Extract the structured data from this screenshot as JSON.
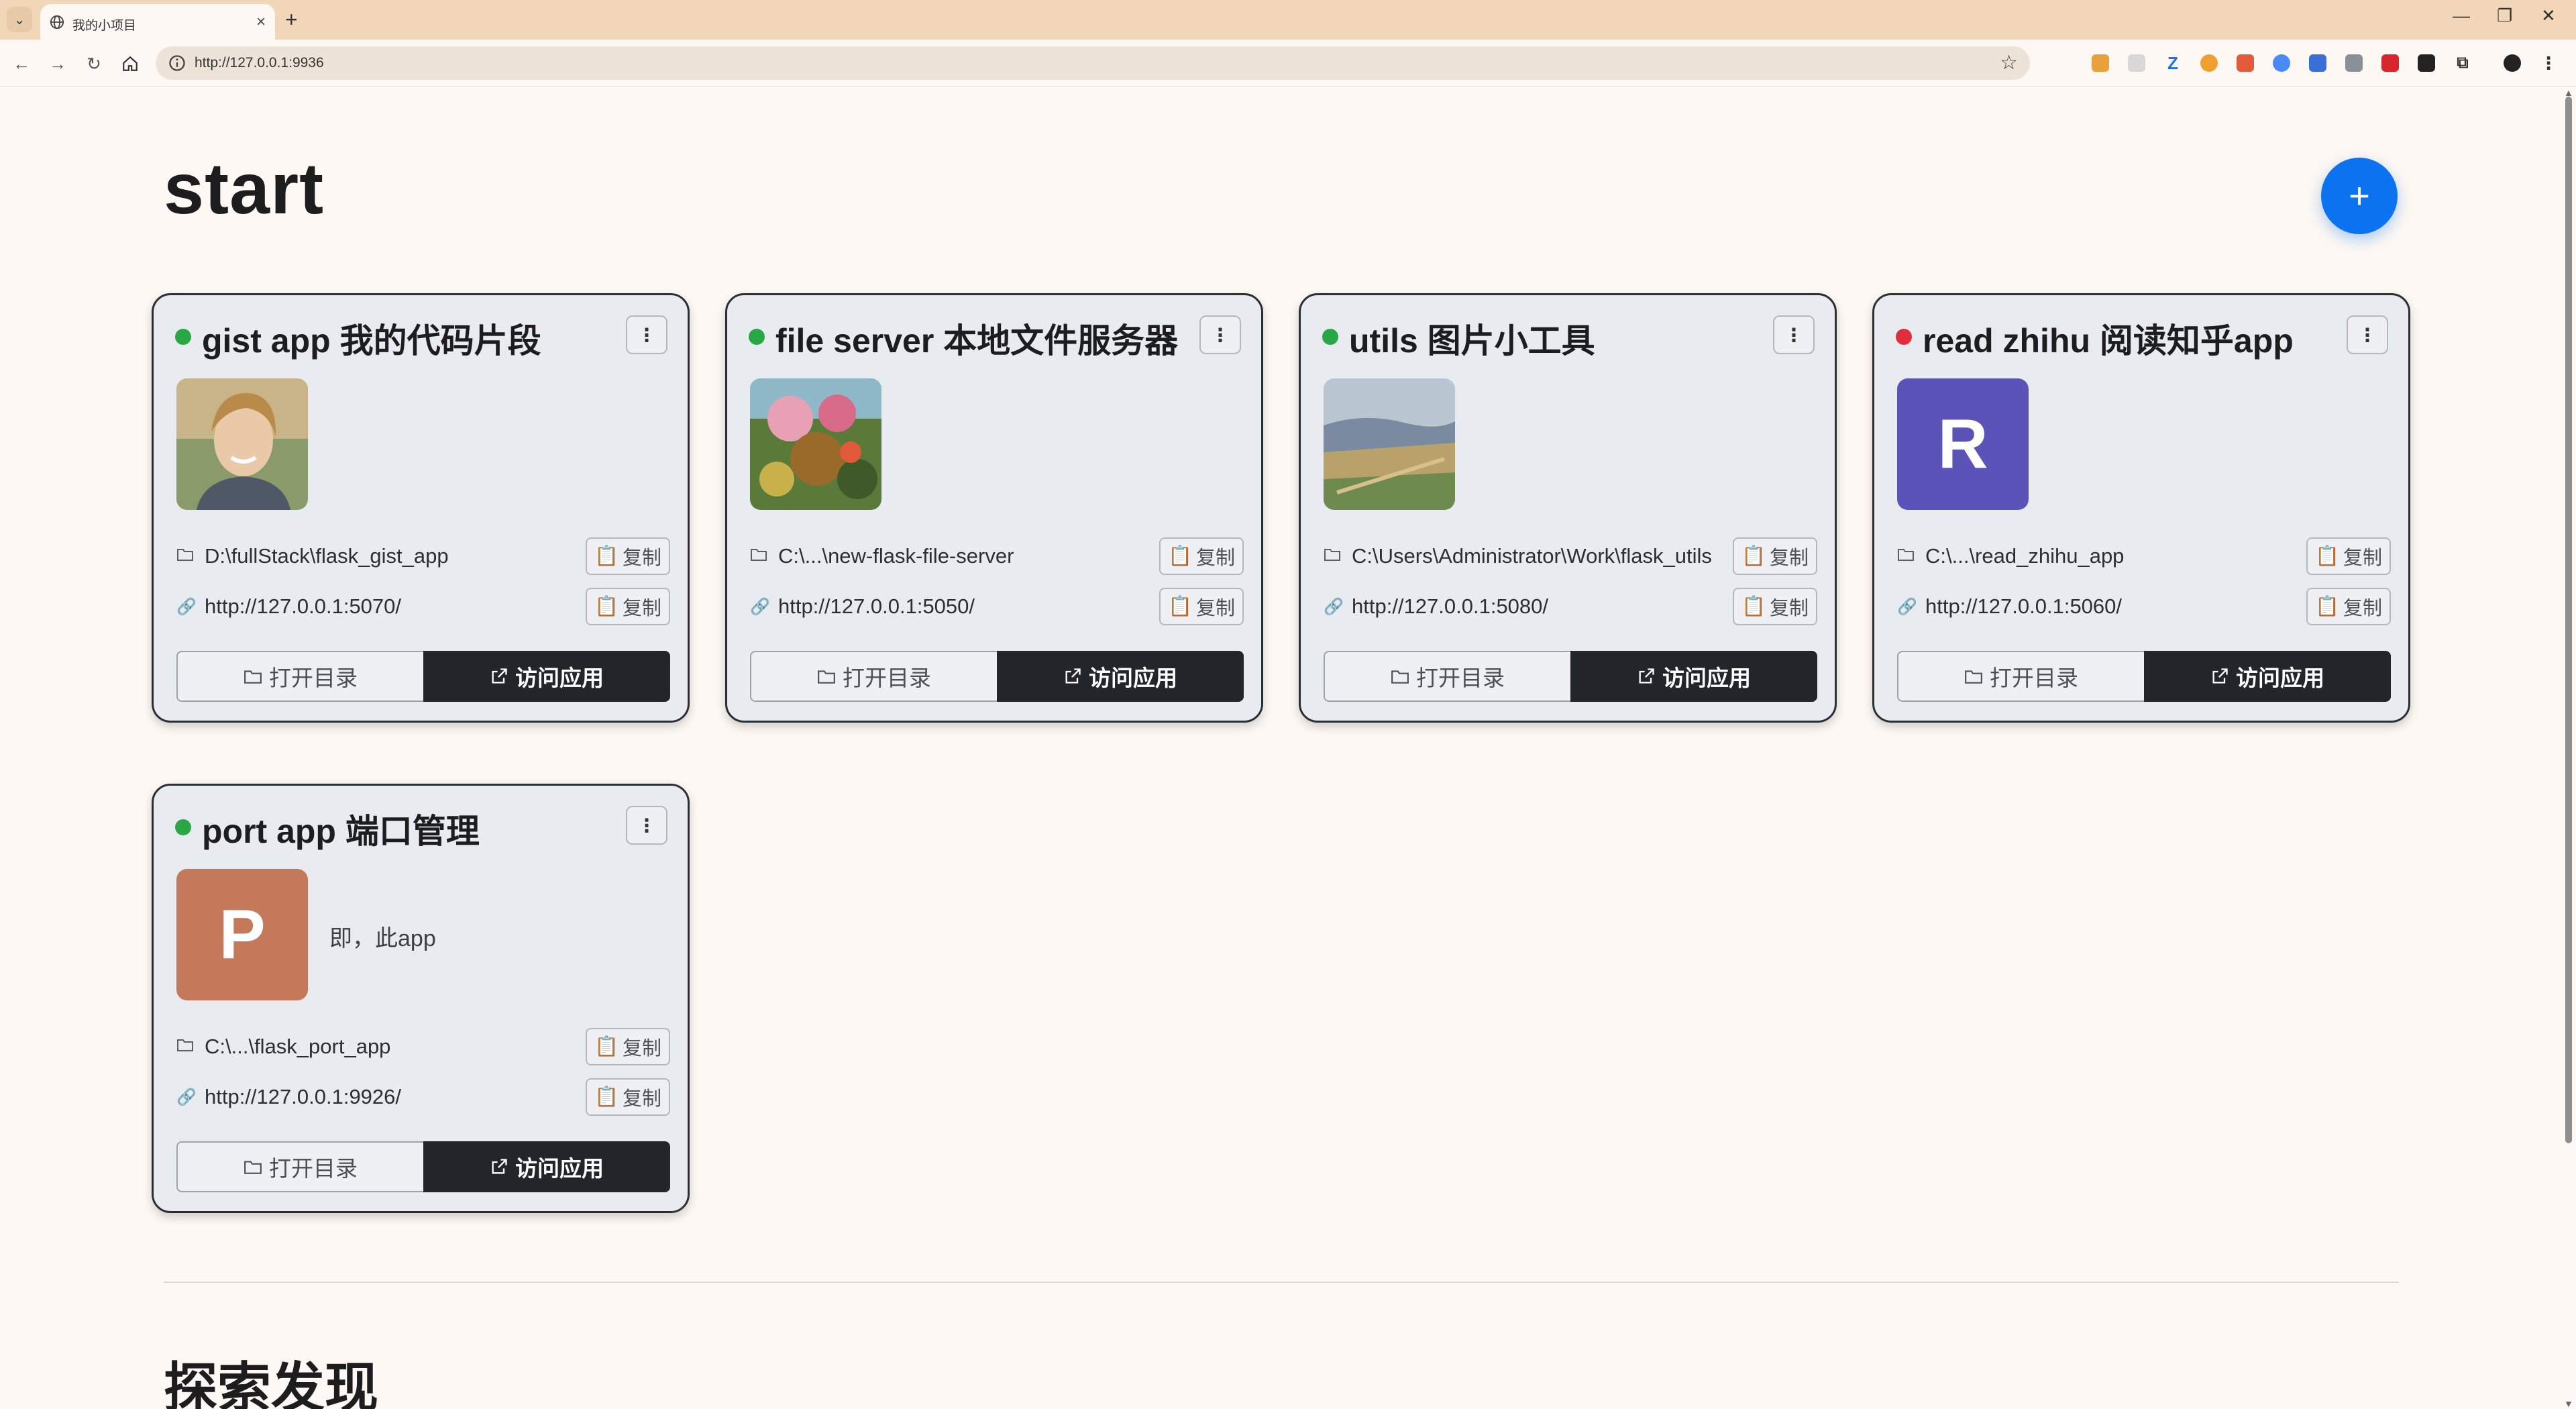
{
  "browser": {
    "tab_title": "我的小项目",
    "address_url": "http://127.0.0.1:9936",
    "new_tab_label": "+",
    "minimize_label": "—",
    "maximize_label": "❐",
    "close_label": "✕"
  },
  "page": {
    "title": "start",
    "add_button_label": "+",
    "section_title": "探索发现"
  },
  "colors": {
    "status_running": "#2aa745",
    "status_stopped": "#e02c3b",
    "accent": "#0c73f0"
  },
  "labels": {
    "copy": "复制",
    "open_dir": "打开目录",
    "visit_app": "访问应用"
  },
  "apps": [
    {
      "name": "gist app 我的代码片段",
      "status": "running",
      "thumbnail": "portrait-photo",
      "path": "D:\\fullStack\\flask_gist_app",
      "url": "http://127.0.0.1:5070/"
    },
    {
      "name": "file server 本地文件服务器",
      "status": "running",
      "thumbnail": "flower-painting",
      "path": "C:\\...\\new-flask-file-server",
      "url": "http://127.0.0.1:5050/"
    },
    {
      "name": "utils 图片小工具",
      "status": "running",
      "thumbnail": "landscape-painting",
      "path": "C:\\Users\\Administrator\\Work\\flask_utils",
      "url": "http://127.0.0.1:5080/"
    },
    {
      "name": "read zhihu 阅读知乎app",
      "status": "stopped",
      "thumbnail": "letter-avatar",
      "avatar_letter": "R",
      "avatar_color": "#5b53b8",
      "path": "C:\\...\\read_zhihu_app",
      "url": "http://127.0.0.1:5060/"
    },
    {
      "name": "port app 端口管理",
      "status": "running",
      "thumbnail": "letter-avatar",
      "avatar_letter": "P",
      "avatar_color": "#c47a5a",
      "description": "即，此app",
      "path": "C:\\...\\flask_port_app",
      "url": "http://127.0.0.1:9926/"
    }
  ]
}
